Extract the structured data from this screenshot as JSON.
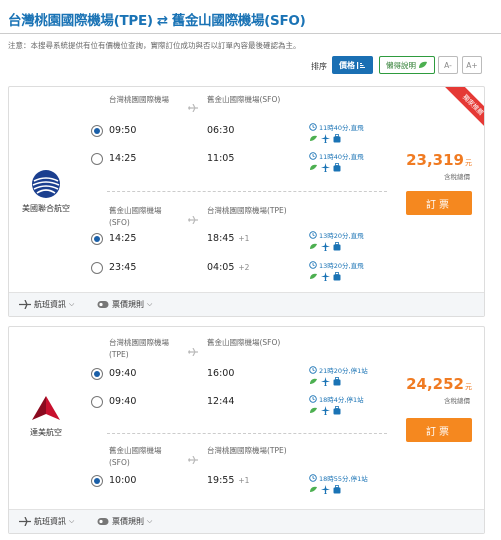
{
  "header": {
    "origin": "台灣桃園國際機場(TPE)",
    "swap_icon": "⇄",
    "destination": "舊金山國際機場(SFO)"
  },
  "notice": "注意：本搜尋系統提供有位有價機位查詢，實際訂位成功與否以訂單內容最後確認為主。",
  "toolbar": {
    "sort_label": "排序",
    "price_button": "價格",
    "rule_button": "懶得說明",
    "font_small": "A-",
    "font_large": "A+"
  },
  "colors": {
    "accent": "#1a6fb3",
    "price": "#f07b22",
    "book": "#f5881f",
    "ribbon": "#e53935"
  },
  "cards": [
    {
      "airline": "美國聯合航空",
      "ribbon": "獨家推薦",
      "price": "23,319",
      "currency": "元",
      "tax_note": "含稅總價",
      "book_label": "訂票",
      "outbound": {
        "from": "台灣桃園國際機場",
        "to": "舊金山國際機場(SFO)",
        "options": [
          {
            "selected": true,
            "dep": "09:50",
            "arr": "06:30",
            "plus": "",
            "duration": "11時40分,直飛"
          },
          {
            "selected": false,
            "dep": "14:25",
            "arr": "11:05",
            "plus": "",
            "duration": "11時40分,直飛"
          }
        ]
      },
      "inbound": {
        "from": "舊金山國際機場",
        "from2": "(SFO)",
        "to": "台灣桃園國際機場(TPE)",
        "options": [
          {
            "selected": true,
            "dep": "14:25",
            "arr": "18:45",
            "plus": "+1",
            "duration": "13時20分,直飛"
          },
          {
            "selected": false,
            "dep": "23:45",
            "arr": "04:05",
            "plus": "+2",
            "duration": "13時20分,直飛"
          }
        ]
      },
      "footer": {
        "flight_info": "航班資訊",
        "fare_rules": "票價規則"
      }
    },
    {
      "airline": "達美航空",
      "price": "24,252",
      "currency": "元",
      "tax_note": "含稅總價",
      "book_label": "訂票",
      "outbound": {
        "from": "台灣桃園國際機場",
        "from2": "(TPE)",
        "to": "舊金山國際機場(SFO)",
        "options": [
          {
            "selected": true,
            "dep": "09:40",
            "arr": "16:00",
            "plus": "",
            "duration": "21時20分,停1站"
          },
          {
            "selected": false,
            "dep": "09:40",
            "arr": "12:44",
            "plus": "",
            "duration": "18時4分,停1站"
          }
        ]
      },
      "inbound": {
        "from": "舊金山國際機場",
        "from2": "(SFO)",
        "to": "台灣桃園國際機場(TPE)",
        "options": [
          {
            "selected": true,
            "dep": "10:00",
            "arr": "19:55",
            "plus": "+1",
            "duration": "18時55分,停1站"
          }
        ]
      },
      "footer": {
        "flight_info": "航班資訊",
        "fare_rules": "票價規則"
      }
    }
  ]
}
